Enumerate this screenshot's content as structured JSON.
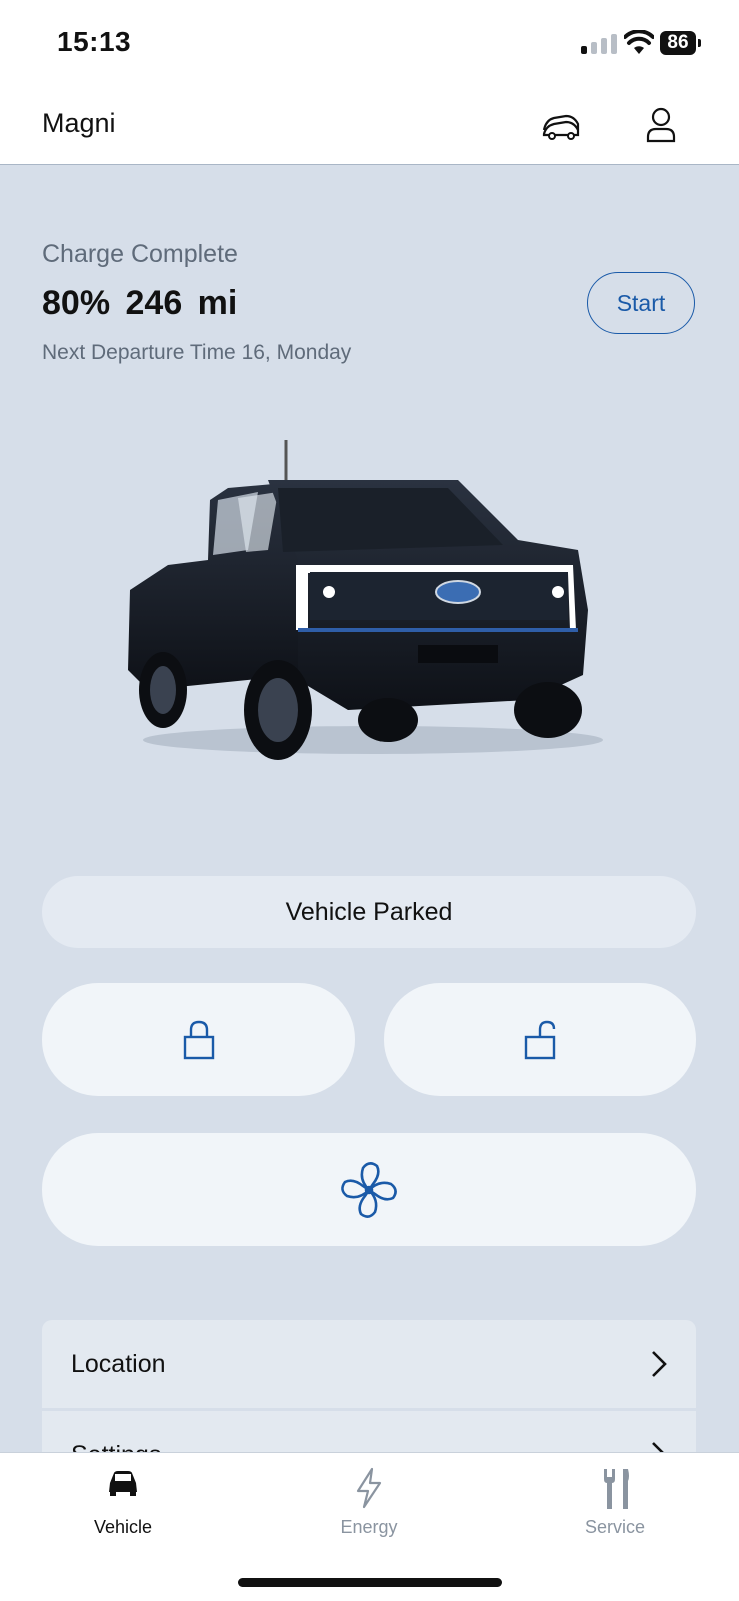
{
  "status_bar": {
    "time": "15:13",
    "battery": "86",
    "icons": [
      "cellular-signal-icon",
      "wifi-icon",
      "battery-icon"
    ]
  },
  "header": {
    "vehicle_name": "Magni",
    "icons": [
      "vehicle-switch-icon",
      "account-icon"
    ]
  },
  "charge": {
    "status": "Charge Complete",
    "metrics": "80%  246 mi",
    "departure": "Next Departure Time 16, Monday",
    "start_label": "Start"
  },
  "vehicle_image": "truck-image",
  "vehicle_state": "Vehicle Parked",
  "controls": {
    "lock_icon": "lock-icon",
    "unlock_icon": "unlock-icon",
    "climate_icon": "fan-icon"
  },
  "menu": {
    "items": [
      {
        "label": "Location"
      },
      {
        "label": "Settings"
      }
    ]
  },
  "bottom_nav": {
    "items": [
      {
        "label": "Vehicle",
        "icon": "car-icon",
        "active": true
      },
      {
        "label": "Energy",
        "icon": "lightning-icon",
        "active": false
      },
      {
        "label": "Service",
        "icon": "tools-icon",
        "active": false
      }
    ]
  },
  "colors": {
    "accent": "#1a5aa8",
    "background": "#d6dee9",
    "inactive": "#8a94a0"
  }
}
